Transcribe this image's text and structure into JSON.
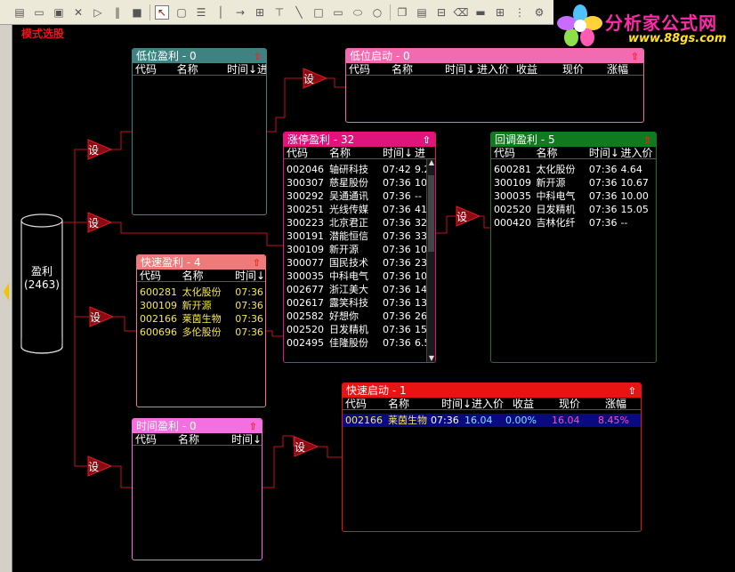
{
  "toolbar": {
    "icons": [
      "doc-icon",
      "folder-icon",
      "save-icon",
      "close-icon",
      "play-icon",
      "pause-icon",
      "stop-icon",
      "pointer-icon",
      "shape-icon",
      "list-icon",
      "arrow-icon",
      "group-icon",
      "filter-icon",
      "line-icon",
      "rect-icon",
      "rect2-icon",
      "ellipse-icon",
      "circle-icon",
      "copy-icon",
      "paste-icon",
      "delete-icon",
      "trash-icon",
      "bar-icon",
      "grid-icon",
      "align-icon",
      "tools-icon"
    ]
  },
  "logo": {
    "title": "分析家公式网",
    "url": "www.88gs.com"
  },
  "mode_label": "模式选股",
  "source": {
    "name": "盈利",
    "count": "(2463)"
  },
  "set_label": "设",
  "panels": {
    "low_profit": {
      "title": "低位盈利 - 0",
      "columns": [
        "代码",
        "名称",
        "时间↓",
        "进"
      ],
      "rows": []
    },
    "low_start": {
      "title": "低位启动 - 0",
      "columns": [
        "代码",
        "名称",
        "时间↓",
        "进入价",
        "收益",
        "现价",
        "涨幅"
      ],
      "rows": []
    },
    "limit_up": {
      "title": "涨停盈利 - 32",
      "columns": [
        "代码",
        "名称",
        "时间↓",
        "进"
      ],
      "rows": [
        [
          "002046",
          "轴研科技",
          "07:42",
          "9.2"
        ],
        [
          "300307",
          "慈星股份",
          "07:36",
          "10"
        ],
        [
          "300292",
          "吴通通讯",
          "07:36",
          "--"
        ],
        [
          "300251",
          "光线传媒",
          "07:36",
          "41"
        ],
        [
          "300223",
          "北京君正",
          "07:36",
          "32"
        ],
        [
          "300191",
          "潜能恒信",
          "07:36",
          "33"
        ],
        [
          "300109",
          "新开源",
          "07:36",
          "10"
        ],
        [
          "300077",
          "国民技术",
          "07:36",
          "23"
        ],
        [
          "300035",
          "中科电气",
          "07:36",
          "10"
        ],
        [
          "002677",
          "浙江美大",
          "07:36",
          "14"
        ],
        [
          "002617",
          "露笑科技",
          "07:36",
          "13"
        ],
        [
          "002582",
          "好想你",
          "07:36",
          "26"
        ],
        [
          "002520",
          "日发精机",
          "07:36",
          "15"
        ],
        [
          "002495",
          "佳隆股份",
          "07:36",
          "6.5"
        ]
      ]
    },
    "pullback": {
      "title": "回调盈利 - 5",
      "columns": [
        "代码",
        "名称",
        "时间↓",
        "进入价"
      ],
      "rows": [
        [
          "600281",
          "太化股份",
          "07:36",
          "4.64"
        ],
        [
          "300109",
          "新开源",
          "07:36",
          "10.67"
        ],
        [
          "300035",
          "中科电气",
          "07:36",
          "10.00"
        ],
        [
          "002520",
          "日发精机",
          "07:36",
          "15.05"
        ],
        [
          "000420",
          "吉林化纤",
          "07:36",
          "--"
        ]
      ]
    },
    "fast_profit": {
      "title": "快速盈利 - 4",
      "columns": [
        "代码",
        "名称",
        "时间↓"
      ],
      "rows": [
        [
          "600281",
          "太化股份",
          "07:36"
        ],
        [
          "300109",
          "新开源",
          "07:36"
        ],
        [
          "002166",
          "莱茵生物",
          "07:36"
        ],
        [
          "600696",
          "多伦股份",
          "07:36"
        ]
      ]
    },
    "time_profit": {
      "title": "时间盈利 - 0",
      "columns": [
        "代码",
        "名称",
        "时间↓"
      ],
      "rows": []
    },
    "fast_start": {
      "title": "快速启动 - 1",
      "columns": [
        "代码",
        "名称",
        "时间↓",
        "进入价",
        "收益",
        "现价",
        "涨幅"
      ],
      "rows": [
        [
          "002166",
          "莱茵生物",
          "07:36",
          "16.04",
          "0.00%",
          "16.04",
          "8.45%"
        ]
      ]
    }
  },
  "colors": {
    "low_profit_head": "#3f8282",
    "low_start_head": "#f26bb0",
    "limit_up_head": "#e0147a",
    "pullback_head": "#0f7a1e",
    "fast_profit_head": "#f07a7a",
    "time_profit_head": "#f46fe0",
    "fast_start_head": "#e81414",
    "connector": "#c0141e"
  }
}
